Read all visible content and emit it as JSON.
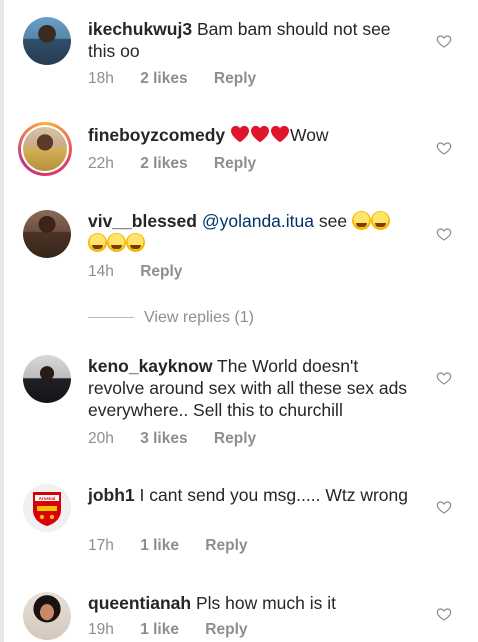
{
  "comments": [
    {
      "username": "ikechukwuj3",
      "text": "Bam bam should not see this oo",
      "time": "18h",
      "likes": "2 likes",
      "reply": "Reply"
    },
    {
      "username": "fineboyzcomedy",
      "text": "Wow",
      "time": "22h",
      "likes": "2 likes",
      "reply": "Reply"
    },
    {
      "username": "viv__blessed",
      "mention": "@yolanda.itua",
      "text": "see",
      "time": "14h",
      "reply": "Reply"
    },
    {
      "username": "keno_kayknow",
      "text": "The World doesn't revolve around sex with all these sex ads everywhere.. Sell this to churchill",
      "time": "20h",
      "likes": "3 likes",
      "reply": "Reply"
    },
    {
      "username": "jobh1",
      "text": "I cant send you msg..... Wtz wrong",
      "time": "17h",
      "likes": "1 like",
      "reply": "Reply"
    },
    {
      "username": "queentianah",
      "text": "Pls how much is it",
      "time": "19h",
      "likes": "1 like",
      "reply": "Reply"
    }
  ],
  "view_replies": "View replies (1)",
  "avatar_labels": {
    "jobh1": "Arsenal"
  },
  "colors": {
    "text": "#262626",
    "meta": "#8e8e8e",
    "mention": "#003569",
    "heart_emoji": "#e0152b"
  }
}
